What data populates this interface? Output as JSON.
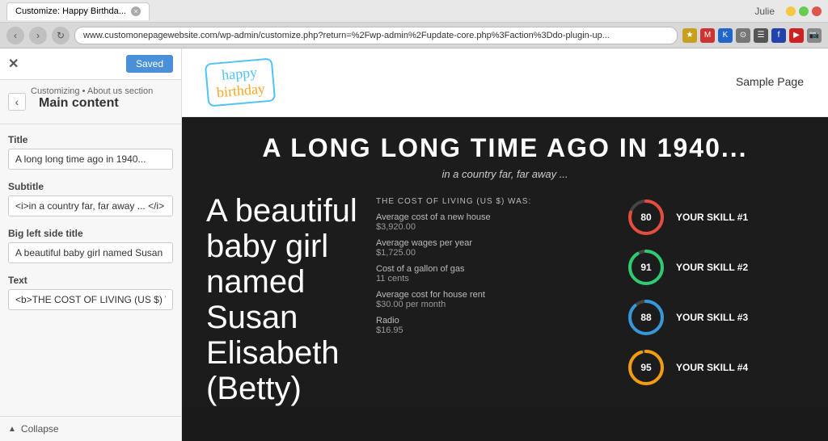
{
  "browser": {
    "tab_title": "Customize: Happy Birthda...",
    "url": "www.customonepagewebsite.com/wp-admin/customize.php?return=%2Fwp-admin%2Fupdate-core.php%3Faction%3Ddo-plugin-up...",
    "user": "Julie"
  },
  "sidebar": {
    "saved_label": "Saved",
    "breadcrumb": "Customizing • About us section",
    "section_title": "Main content",
    "fields": [
      {
        "label": "Title",
        "value": "A long long time ago in 1940...",
        "id": "title"
      },
      {
        "label": "Subtitle",
        "value": "<i>in a country far, far away ... </i>",
        "id": "subtitle"
      },
      {
        "label": "Big left side title",
        "value": "A beautiful baby girl named Susan Elisab",
        "id": "big-left"
      },
      {
        "label": "Text",
        "value": "<b>THE COST OF LIVING (US $) WAS:</b",
        "id": "text"
      }
    ],
    "collapse_label": "Collapse"
  },
  "site": {
    "logo_happy": "happy",
    "logo_birthday": "birthday",
    "nav_link": "Sample Page",
    "hero_title": "A LONG LONG TIME AGO IN 1940...",
    "hero_subtitle": "in a country far, far away ...",
    "big_left_text": "A beautiful baby girl named Susan Elisabeth (Betty)",
    "stats_title": "THE COST OF LIVING (US $) WAS:",
    "stats": [
      {
        "name": "Average cost of a new house",
        "value": "$3,920.00"
      },
      {
        "name": "Average wages per year",
        "value": "$1,725.00"
      },
      {
        "name": "Cost of a gallon of gas",
        "value": "11 cents"
      },
      {
        "name": "Average cost for house rent",
        "value": "$30.00 per month"
      },
      {
        "name": "Radio",
        "value": "$16.95"
      }
    ],
    "skills": [
      {
        "label": "YOUR SKILL #1",
        "value": 80,
        "color": "#e74c3c",
        "circumference": 125.66,
        "offset": 25.13
      },
      {
        "label": "YOUR SKILL #2",
        "value": 91,
        "color": "#2ecc71",
        "circumference": 125.66,
        "offset": 11.31
      },
      {
        "label": "YOUR SKILL #3",
        "value": 88,
        "color": "#3498db",
        "circumference": 125.66,
        "offset": 15.08
      },
      {
        "label": "YOUR SKILL #4",
        "value": 95,
        "color": "#f39c12",
        "circumference": 125.66,
        "offset": 6.28
      }
    ]
  }
}
